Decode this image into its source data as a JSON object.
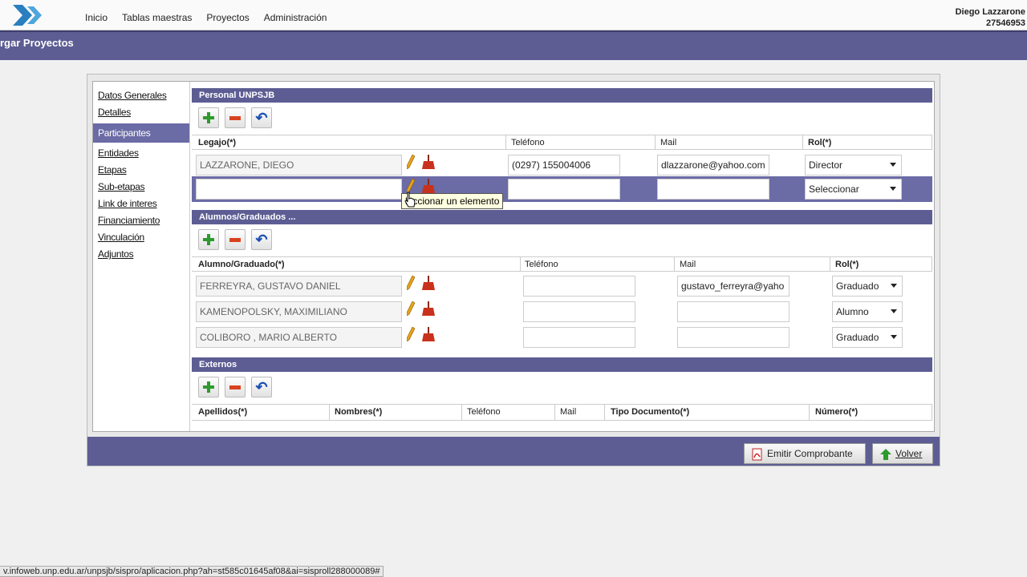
{
  "nav": {
    "inicio": "Inicio",
    "tablas": "Tablas maestras",
    "proyectos": "Proyectos",
    "admin": "Administración"
  },
  "user": {
    "name": "Diego Lazzarone",
    "id": "27546953"
  },
  "page_title": "rgar Proyectos",
  "sidebar": {
    "items": [
      "Datos Generales",
      "Detalles",
      "Participantes",
      "Entidades",
      "Etapas",
      "Sub-etapas",
      "Link de interes",
      "Financiamiento",
      "Vinculación",
      "Adjuntos"
    ]
  },
  "personal": {
    "title": "Personal UNPSJB",
    "headers": {
      "legajo": "Legajo(*)",
      "telefono": "Teléfono",
      "mail": "Mail",
      "rol": "Rol(*)"
    },
    "rows": [
      {
        "legajo": "LAZZARONE, DIEGO",
        "telefono": "(0297) 155004006",
        "mail": "dlazzarone@yahoo.com",
        "rol": "Director"
      },
      {
        "legajo": "",
        "telefono": "",
        "mail": "",
        "rol": "Seleccionar"
      }
    ]
  },
  "tooltip": "leccionar un elemento",
  "alumnos": {
    "title": "Alumnos/Graduados ...",
    "headers": {
      "alumno": "Alumno/Graduado(*)",
      "telefono": "Teléfono",
      "mail": "Mail",
      "rol": "Rol(*)"
    },
    "rows": [
      {
        "alumno": "FERREYRA,  GUSTAVO DANIEL",
        "telefono": "",
        "mail": "gustavo_ferreyra@yaho",
        "rol": "Graduado"
      },
      {
        "alumno": "KAMENOPOLSKY, MAXIMILIANO",
        "telefono": "",
        "mail": "",
        "rol": "Alumno"
      },
      {
        "alumno": "COLIBORO , MARIO ALBERTO",
        "telefono": "",
        "mail": "",
        "rol": "Graduado"
      }
    ]
  },
  "externos": {
    "title": "Externos",
    "headers": {
      "apellidos": "Apellidos(*)",
      "nombres": "Nombres(*)",
      "telefono": "Teléfono",
      "mail": "Mail",
      "tipo_doc": "Tipo Documento(*)",
      "numero": "Número(*)"
    }
  },
  "buttons": {
    "emitir": "Emitir Comprobante",
    "volver": "Volver"
  },
  "status_url": "v.infoweb.unp.edu.ar/unpsjb/sispro/aplicacion.php?ah=st585c01645af08&ai=sisproll288000089#"
}
